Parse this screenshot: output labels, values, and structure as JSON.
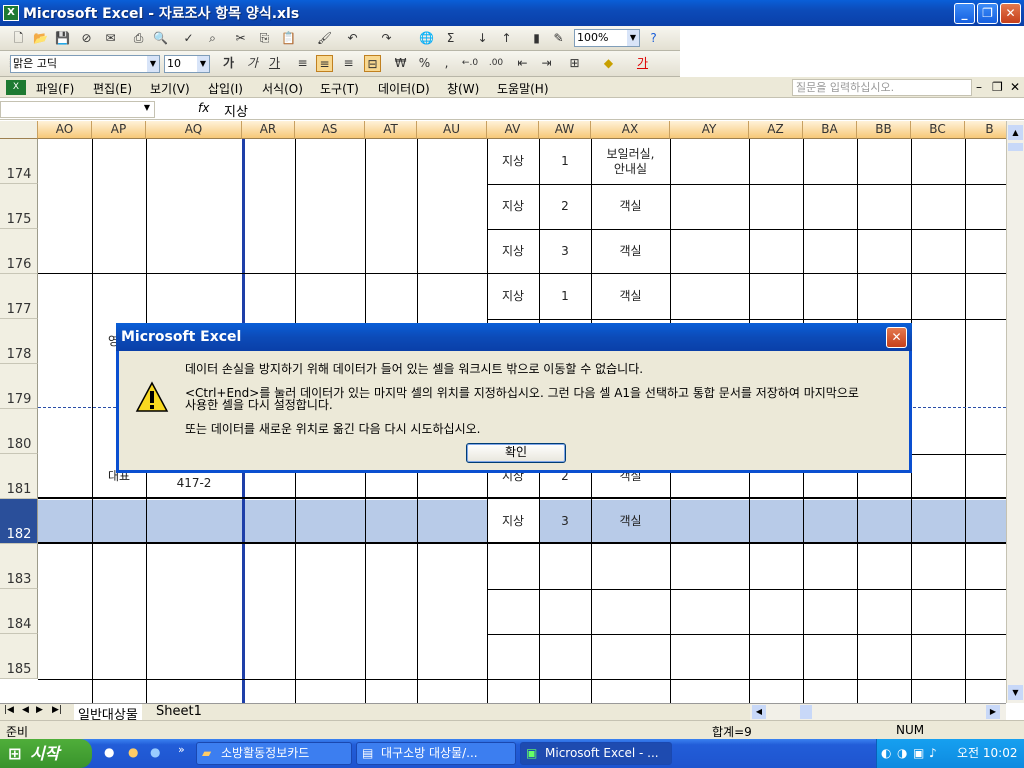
{
  "window": {
    "title": "Microsoft Excel - 자료조사 항목 양식.xls",
    "app_icon": "excel-icon"
  },
  "toolbar": {
    "zoom": "100%",
    "font_name": "맑은 고딕",
    "font_size": "10",
    "bold": "가",
    "italic": "가",
    "underline": "가",
    "currency": "₩",
    "percent": "%",
    "comma": ",",
    "inc_decimal": "←.0",
    "dec_decimal": ".00",
    "font_color_glyph": "가",
    "sum_glyph": "Σ"
  },
  "menu": {
    "items": [
      "파일(F)",
      "편집(E)",
      "보기(V)",
      "삽입(I)",
      "서식(O)",
      "도구(T)",
      "데이터(D)",
      "창(W)",
      "도움말(H)"
    ],
    "help_placeholder": "질문을 입력하십시오."
  },
  "formula_bar": {
    "name_box": "",
    "fx": "fx",
    "content": "지상"
  },
  "grid": {
    "columns": [
      "AO",
      "AP",
      "AQ",
      "AR",
      "AS",
      "AT",
      "AU",
      "AV",
      "AW",
      "AX",
      "AY",
      "AZ",
      "BA",
      "BB",
      "BC",
      "B"
    ],
    "rows": [
      "174",
      "175",
      "176",
      "177",
      "178",
      "179",
      "180",
      "181",
      "182",
      "183",
      "184",
      "185"
    ],
    "cells": {
      "r174_av": "지상",
      "r174_aw": "1",
      "r174_ax": "보일러실,\n안내실",
      "r175_av": "지상",
      "r175_aw": "2",
      "r175_ax": "객실",
      "r176_av": "지상",
      "r176_aw": "3",
      "r176_ax": "객실",
      "r177_av": "지상",
      "r177_aw": "1",
      "r177_ax": "객실",
      "r178_ap": "영업",
      "r181_ap": "대표",
      "r181_aq": "417-2",
      "r181_av": "지상",
      "r181_aw": "2",
      "r181_ax": "객실",
      "r182_av": "지상",
      "r182_aw": "3",
      "r182_ax": "객실"
    }
  },
  "sheet_tabs": {
    "tabs": [
      "일반대상물",
      "Sheet1"
    ]
  },
  "status": {
    "left": "준비",
    "sum": "합계=9",
    "num": "NUM"
  },
  "dialog": {
    "title": "Microsoft Excel",
    "line1": "데이터 손실을 방지하기 위해 데이터가 들어 있는 셀을 워크시트 밖으로 이동할 수 없습니다.",
    "line2a": "<Ctrl+End>를 눌러 데이터가 있는 마지막 셀의 위치를 지정하십시오. 그런 다음 셀 A1을 선택하고 통합 문서를 저장하여 마지막으로",
    "line2b": "사용한 셀을 다시 설정합니다.",
    "line3": "또는 데이터를 새로운 위치로 옮긴 다음 다시 시도하십시오.",
    "ok": "확인",
    "icon": "warning-icon"
  },
  "taskbar": {
    "start": "시작",
    "tasks": [
      "소방활동정보카드",
      "대구소방 대상물/...",
      "Microsoft Excel - ..."
    ],
    "clock": "오전 10:02"
  }
}
